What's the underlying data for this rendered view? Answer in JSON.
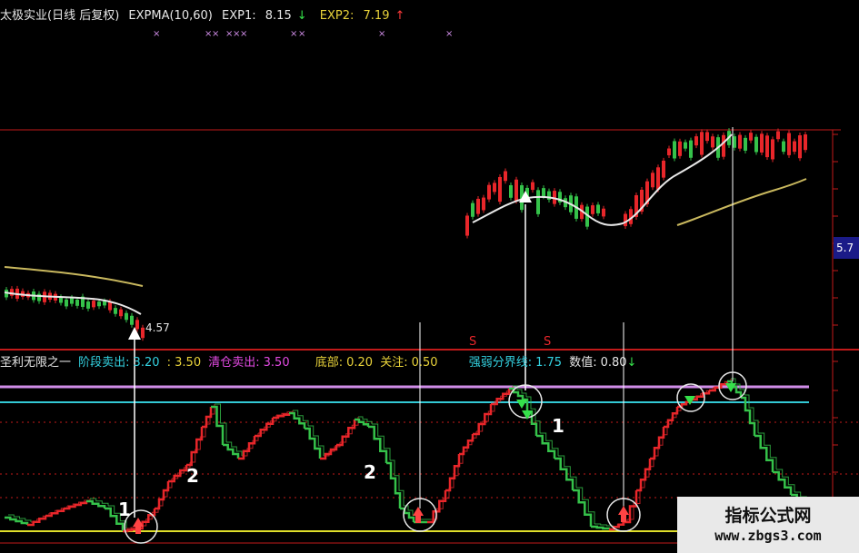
{
  "header": {
    "stock": "太极实业(日线 后复权)",
    "indicator": "EXPMA(10,60)",
    "exp1_label": "EXP1:",
    "exp1_value": "8.15",
    "exp1_arrow": "↓",
    "exp2_label": "EXP2:",
    "exp2_value": "7.19",
    "exp2_arrow": "↑"
  },
  "price_axis_tag": "5.7",
  "low_price_label": "4.57",
  "indicator_header": {
    "name": "圣利无限之一",
    "stage_sell": "阶段卖出:",
    "stage_sell_value": "3.20",
    "stage_sell_alt": ": 3.50",
    "clear_sell": "清仓卖出:",
    "clear_sell_value": "3.50",
    "bottom": "底部:",
    "bottom_value": "0.20",
    "focus": "关注:",
    "focus_value": "0.50",
    "strong_weak": "强弱分界线:",
    "strong_weak_value": "1.75",
    "value_label": "数值:",
    "value_value": "0.80",
    "value_arrow": "↓"
  },
  "marks": {
    "s1": "S",
    "s2": "S",
    "n1": "1",
    "n2": "2",
    "n3": "2",
    "n4": "1"
  },
  "watermark": {
    "title": "指标公式网",
    "url": "www.zbgs3.com"
  },
  "colors": {
    "bg": "#000000",
    "up_candle": "#e8262a",
    "down_candle": "#35c24a",
    "exp1": "#e8e8e8",
    "exp2": "#c9b85e",
    "grid_red": "#c21a1a",
    "magenta": "#d08de8",
    "cyan": "#33c9d4",
    "yellow": "#dede2a",
    "arrow_white": "#ffffff",
    "label_cyan": "#33d1e0",
    "label_yellow": "#e8d23a",
    "label_magenta": "#e24ae2",
    "label_white": "#e6e6e6"
  },
  "icons": [
    "up-arrow-icon",
    "down-arrow-icon",
    "circle-marker-icon",
    "white-triangle-icon"
  ]
}
